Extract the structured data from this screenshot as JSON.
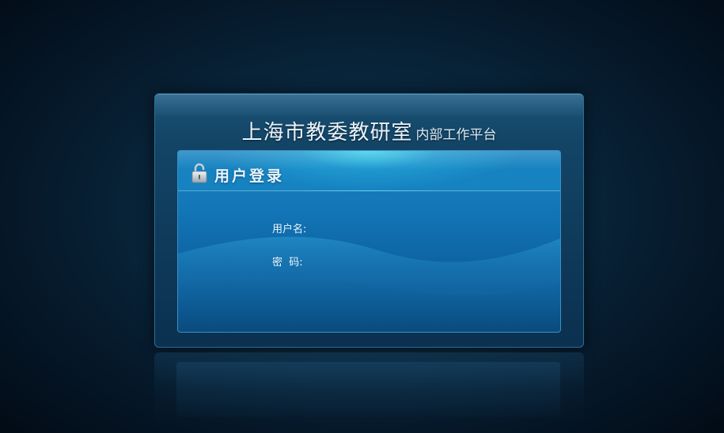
{
  "header": {
    "title_main": "上海市教委教研室",
    "title_sub": "内部工作平台"
  },
  "login": {
    "title": "用户登录",
    "username_label": "用户名:",
    "password_label": "密  码:",
    "username_value": "",
    "password_value": ""
  },
  "icons": {
    "lock": "lock-icon"
  },
  "colors": {
    "background": "#041322",
    "panel": "#134567",
    "inner_panel": "#1377b8",
    "header_glow": "#3fd0e8",
    "text": "#eef6fb"
  }
}
